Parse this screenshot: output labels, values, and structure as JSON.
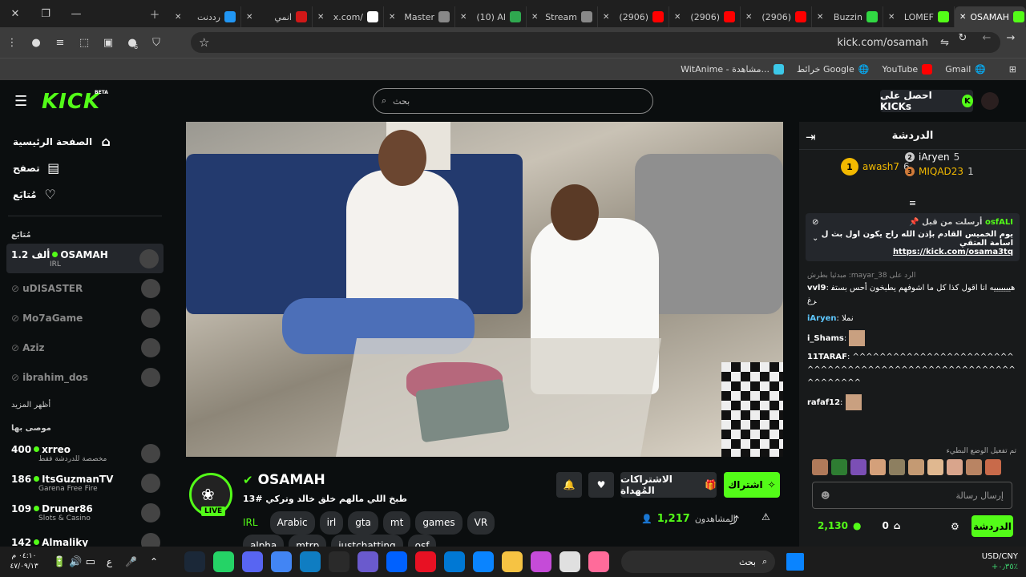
{
  "browser": {
    "tabs": [
      {
        "label": "OSAMAH",
        "color": "#53fc18"
      },
      {
        "label": "LOMEF",
        "color": "#53fc18"
      },
      {
        "label": "Buzzin",
        "color": "#31d843"
      },
      {
        "label": "(2906)",
        "color": "#ff0000"
      },
      {
        "label": "(2906)",
        "color": "#ff0000"
      },
      {
        "label": "(2906)",
        "color": "#ff0000"
      },
      {
        "label": "Stream",
        "color": "#888888"
      },
      {
        "label": "(10) Al",
        "color": "#2fa84f"
      },
      {
        "label": "Master",
        "color": "#888888"
      },
      {
        "label": "x.com/",
        "color": "#ffffff"
      },
      {
        "label": "انمي",
        "color": "#d01818"
      },
      {
        "label": "رددنت",
        "color": "#2196f3"
      }
    ],
    "url": "kick.com/osamah",
    "bookmarks": [
      "WitAnime - مشاهدة...",
      "خرائط Google",
      "YouTube",
      "Gmail"
    ],
    "extension_badge": "6"
  },
  "header": {
    "logo": "KICK",
    "beta": "BETA",
    "search_placeholder": "بحث",
    "kicks_button": "احصل على KICKs"
  },
  "sidebar": {
    "nav": [
      {
        "label": "الصفحة الرئيسية",
        "icon": "home-icon"
      },
      {
        "label": "تصفح",
        "icon": "browse-icon"
      },
      {
        "label": "مُتابَع",
        "icon": "heart-icon"
      }
    ],
    "following_label": "مُتابَع",
    "following": [
      {
        "name": "OSAMAH",
        "viewers": "1.2 ألف",
        "sub": "IRL",
        "live": true
      },
      {
        "name": "uDISASTER",
        "live": false
      },
      {
        "name": "Mo7aGame",
        "live": false
      },
      {
        "name": "Aziz",
        "live": false
      },
      {
        "name": "ibrahim_dos",
        "live": false
      }
    ],
    "show_more": "أظهر المزيد",
    "recommended_label": "موصى بها",
    "recommended": [
      {
        "name": "xrreo",
        "viewers": "400",
        "sub": "مخصصة للدردشة فقط"
      },
      {
        "name": "ItsGuzmanTV",
        "viewers": "186",
        "sub": "Garena Free Fire"
      },
      {
        "name": "Druner86",
        "viewers": "109",
        "sub": "Slots & Casino"
      },
      {
        "name": "Almaliky",
        "viewers": "142",
        "sub": ""
      }
    ]
  },
  "stream": {
    "channel": "OSAMAH",
    "title": "طبخ اللي مالهم خلق خالد وتركي #13",
    "live_badge": "LIVE",
    "tags": [
      "IRL",
      "Arabic",
      "irl",
      "gta",
      "mt",
      "games",
      "VR",
      "alpha",
      "mtrp",
      "justchatting",
      "osf"
    ],
    "viewers_label": "المشاهدون",
    "viewers": "1,217",
    "subscribe": "اشتراك",
    "gift_subs": "الاشتراكات المُهداة"
  },
  "chat": {
    "title": "الدردشة",
    "leaderboard": [
      {
        "rank": "1",
        "name": "awash7",
        "count": "6"
      },
      {
        "rank": "2",
        "name": "iAryen",
        "count": "5"
      },
      {
        "rank": "3",
        "name": "MIQAD23",
        "count": "1"
      }
    ],
    "pinned": {
      "label": "أرسلت من قبل",
      "user": "osfALI",
      "text": "يوم الخميس القادم بإذن الله راح يكون اول بث ل اسامة العتقي",
      "link": "https://kick.com/osama3tq"
    },
    "messages": [
      {
        "user": "vvl9",
        "reply": "الرد على mayar_38: مبدئيا بطرش",
        "text": "هيييييييه انا اقول كذا كل ما اشوفهم يطبخون أحس بستفرغ"
      },
      {
        "user": "iAryen",
        "text": "نملا"
      },
      {
        "user": "i_Shams",
        "text": ""
      },
      {
        "user": "11TARAF",
        "text": "^^^^^^^^^^^^^^^^^^^^^^^^^^^^^^^^^^^^^^^^^^^^^^^^^^^^^^^^^^^^^^^"
      },
      {
        "user": "rafaf12",
        "text": ""
      }
    ],
    "emote_mode": "تم تفعيل الوضع البطيء",
    "input_placeholder": "إرسال رسالة",
    "points": "2,130",
    "tokens": "0",
    "chat_button": "الدردشة"
  },
  "taskbar": {
    "search": "بحث",
    "currency": "USD/CNY",
    "change": "+٠٫٣٥٪",
    "time": "٠٤:١٠ م",
    "date": "٤٧/٠٩/١٣",
    "lang": "ع"
  }
}
